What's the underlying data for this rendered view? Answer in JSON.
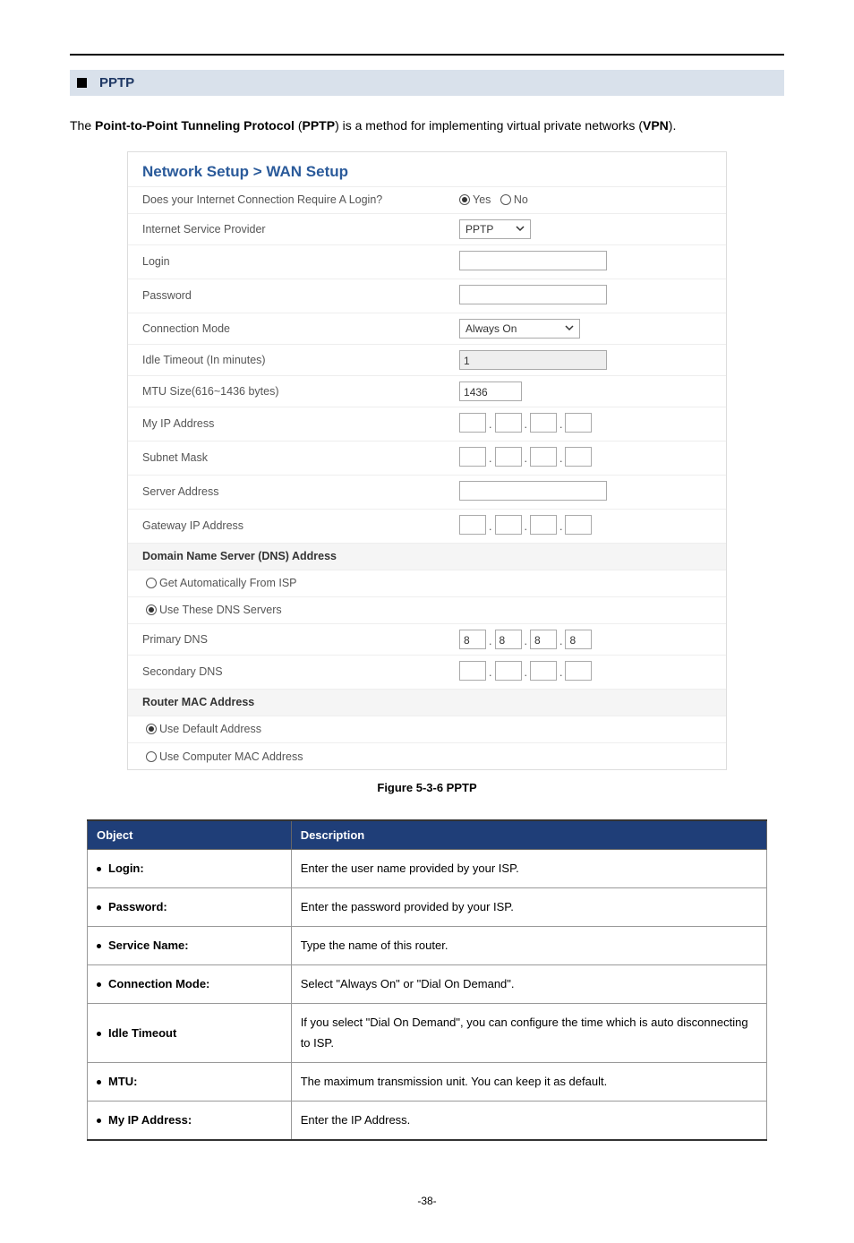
{
  "section": {
    "heading": "PPTP",
    "intro_prefix": "The ",
    "intro_bold1": "Point-to-Point Tunneling Protocol",
    "intro_paren_open": " (",
    "intro_bold2": "PPTP",
    "intro_mid": ") is a method for implementing virtual private networks (",
    "intro_bold3": "VPN",
    "intro_suffix": ")."
  },
  "screenshot": {
    "title": "Network Setup > WAN Setup",
    "rows": {
      "require_login_label": "Does your Internet Connection Require A Login?",
      "require_login_yes": "Yes",
      "require_login_no": "No",
      "isp_label": "Internet Service Provider",
      "isp_value": "PPTP",
      "login_label": "Login",
      "password_label": "Password",
      "conn_mode_label": "Connection Mode",
      "conn_mode_value": "Always On",
      "idle_label": "Idle Timeout (In minutes)",
      "idle_value": "1",
      "mtu_label": "MTU Size(616~1436 bytes)",
      "mtu_value": "1436",
      "myip_label": "My IP Address",
      "subnet_label": "Subnet Mask",
      "server_label": "Server Address",
      "gateway_label": "Gateway IP Address",
      "dns_heading": "Domain Name Server (DNS) Address",
      "dns_auto": "Get Automatically From ISP",
      "dns_use": "Use These DNS Servers",
      "primary_dns_label": "Primary DNS",
      "primary_dns_values": [
        "8",
        "8",
        "8",
        "8"
      ],
      "secondary_dns_label": "Secondary DNS",
      "mac_heading": "Router MAC Address",
      "mac_default": "Use Default Address",
      "mac_computer": "Use Computer MAC Address"
    }
  },
  "figure_caption": "Figure 5-3-6 PPTP",
  "table": {
    "head_object": "Object",
    "head_desc": "Description",
    "rows": [
      {
        "object": "Login:",
        "desc": "Enter the user name provided by your ISP."
      },
      {
        "object": "Password:",
        "desc": "Enter the password provided by your ISP."
      },
      {
        "object": "Service Name:",
        "desc": "Type the name of this router."
      },
      {
        "object": "Connection Mode:",
        "desc": "Select \"Always On\" or \"Dial On Demand\"."
      },
      {
        "object": "Idle Timeout",
        "desc": "If you select \"Dial On Demand\", you can configure the time which is auto disconnecting to ISP."
      },
      {
        "object": "MTU:",
        "desc": "The maximum transmission unit. You can keep it as default."
      },
      {
        "object": "My IP Address:",
        "desc": "Enter the IP Address."
      }
    ]
  },
  "page_number": "-38-"
}
